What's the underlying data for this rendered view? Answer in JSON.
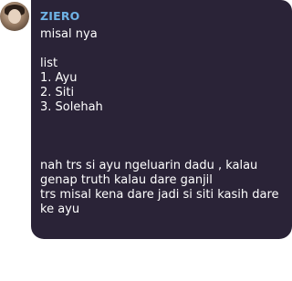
{
  "sender": {
    "name": "ZIERO",
    "color": "#6fb3e6"
  },
  "message": {
    "greeting": "misal nya",
    "list_title": "list",
    "list_items": [
      "1. Ayu",
      "2. Siti",
      "3. Solehah"
    ],
    "paragraph_lines": [
      "nah trs si ayu ngeluarin dadu , kalau",
      "genap truth kalau dare ganjil",
      "trs misal kena dare jadi si siti kasih dare",
      "ke ayu"
    ]
  },
  "colors": {
    "bubble_background": "#2a2337",
    "text": "#ffffff",
    "page_background": "#ffffff"
  }
}
